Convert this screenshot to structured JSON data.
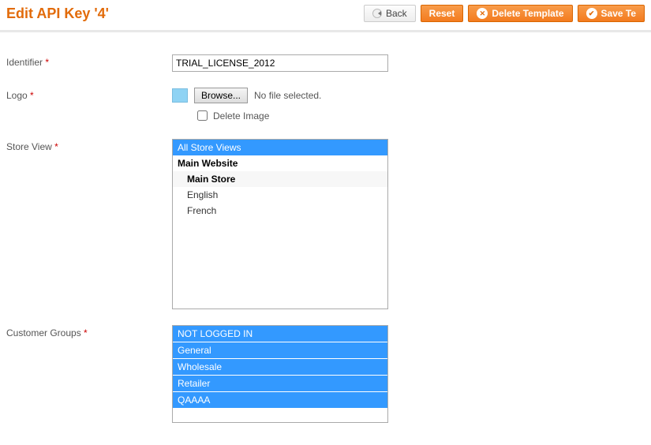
{
  "title": "Edit API Key '4'",
  "toolbar": {
    "back": "Back",
    "reset": "Reset",
    "delete_template": "Delete Template",
    "save_template": "Save Te"
  },
  "labels": {
    "identifier": "Identifier",
    "logo": "Logo",
    "store_view": "Store View",
    "customer_groups": "Customer Groups"
  },
  "identifier": {
    "value": "TRIAL_LICENSE_2012"
  },
  "logo": {
    "browse": "Browse...",
    "no_file": "No file selected.",
    "delete_image": "Delete Image"
  },
  "store_view": {
    "all": "All Store Views",
    "site": "Main Website",
    "store": "Main Store",
    "views": [
      "English",
      "French"
    ]
  },
  "customer_groups": [
    "NOT LOGGED IN",
    "General",
    "Wholesale",
    "Retailer",
    "QAAAA"
  ]
}
